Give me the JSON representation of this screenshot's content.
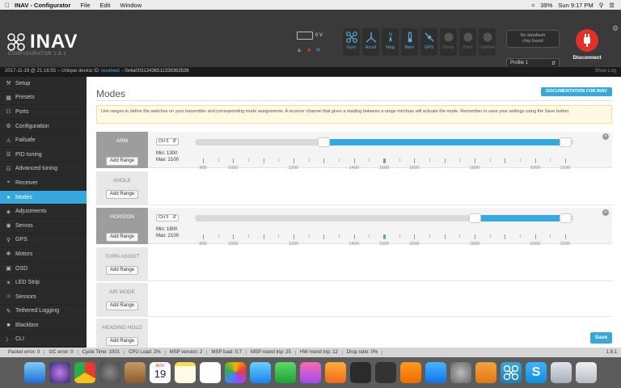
{
  "menubar": {
    "app_name": "INAV - Configurator",
    "items": [
      "File",
      "Edit",
      "Window"
    ],
    "battery": "39%",
    "clock": "Sun 9:17 PM"
  },
  "header": {
    "brand": "INAV",
    "subtitle": "CONFIGURATOR   1.8.1",
    "voltage": "0 V",
    "sensors": [
      {
        "label": "Gyro",
        "icon": "gyro-icon",
        "state": "on"
      },
      {
        "label": "Accel",
        "icon": "accel-icon",
        "state": "on"
      },
      {
        "label": "Mag",
        "icon": "mag-icon",
        "state": "on"
      },
      {
        "label": "Baro",
        "icon": "baro-icon",
        "state": "on"
      },
      {
        "label": "GPS",
        "icon": "gps-icon",
        "state": "on"
      },
      {
        "label": "Sonar",
        "icon": "sonar-icon",
        "state": "off"
      },
      {
        "label": "Pitot",
        "icon": "pitot-icon",
        "state": "off"
      },
      {
        "label": "Optflow",
        "icon": "optflow-icon",
        "state": "off"
      }
    ],
    "dataflash_line1": "No dataflash",
    "dataflash_line2": "chip found",
    "profile": "Profile 1",
    "disconnect": "Disconnect"
  },
  "log": {
    "prefix": "2017-11-19 @ 21:16:55 -- Unique device ID",
    "received": "received",
    "device_id": "- 0x4a00313436511338363536",
    "show_log": "Show Log"
  },
  "sidebar": {
    "items": [
      {
        "label": "Setup",
        "icon": "wrench-icon"
      },
      {
        "label": "Presets",
        "icon": "presets-icon"
      },
      {
        "label": "Ports",
        "icon": "ports-icon"
      },
      {
        "label": "Configuration",
        "icon": "gear-icon"
      },
      {
        "label": "Failsafe",
        "icon": "failsafe-icon"
      },
      {
        "label": "PID tuning",
        "icon": "pid-icon"
      },
      {
        "label": "Advanced tuning",
        "icon": "advanced-tuning-icon"
      },
      {
        "label": "Receiver",
        "icon": "receiver-icon"
      },
      {
        "label": "Modes",
        "icon": "modes-icon"
      },
      {
        "label": "Adjustments",
        "icon": "adjustments-icon"
      },
      {
        "label": "Servos",
        "icon": "servos-icon"
      },
      {
        "label": "GPS",
        "icon": "gps-icon"
      },
      {
        "label": "Motors",
        "icon": "motors-icon"
      },
      {
        "label": "OSD",
        "icon": "osd-icon"
      },
      {
        "label": "LED Strip",
        "icon": "led-icon"
      },
      {
        "label": "Sensors",
        "icon": "sensors-icon"
      },
      {
        "label": "Tethered Logging",
        "icon": "logging-icon"
      },
      {
        "label": "Blackbox",
        "icon": "blackbox-icon"
      },
      {
        "label": "CLI",
        "icon": "cli-icon"
      }
    ],
    "active": "Modes"
  },
  "modes_page": {
    "title": "Modes",
    "documentation_button": "DOCUMENTATION FOR INAV",
    "note": "Use ranges to define the switches on your transmitter and corresponding mode assignments. A receiver channel that gives a reading between a range min/max will activate the mode. Remember to save your settings using the Save button.",
    "add_range_label": "Add Range",
    "save_button": "Save",
    "scale_labels": [
      "900",
      "1000",
      "1200",
      "1400",
      "1500",
      "1600",
      "1800",
      "2000",
      "2100"
    ],
    "modes": [
      {
        "name": "ARM",
        "active": true,
        "channel": "CH 5",
        "min_label": "Min: 1300",
        "max_label": "Max: 2100",
        "range": [
          1300,
          2100
        ],
        "current": 1500
      },
      {
        "name": "ANGLE",
        "active": false
      },
      {
        "name": "HORIZON",
        "active": true,
        "channel": "CH 5",
        "min_label": "Min: 1800",
        "max_label": "Max: 2100",
        "range": [
          1800,
          2100
        ],
        "current": 1500
      },
      {
        "name": "TURN ASSIST",
        "active": false
      },
      {
        "name": "AIR MODE",
        "active": false
      },
      {
        "name": "HEADING HOLD",
        "active": false
      }
    ]
  },
  "status": {
    "items": [
      "Packet error: 0",
      "I2C error: 0",
      "Cycle Time: 1001",
      "CPU Load: 2%",
      "MSP version: 2",
      "MSP load: 0.7",
      "MSP round trip: 25",
      "HW round trip: 12",
      "Drop ratio: 0%"
    ],
    "version": "1.8.1"
  },
  "dock": {
    "calendar_month": "NOV",
    "calendar_day": "19"
  }
}
